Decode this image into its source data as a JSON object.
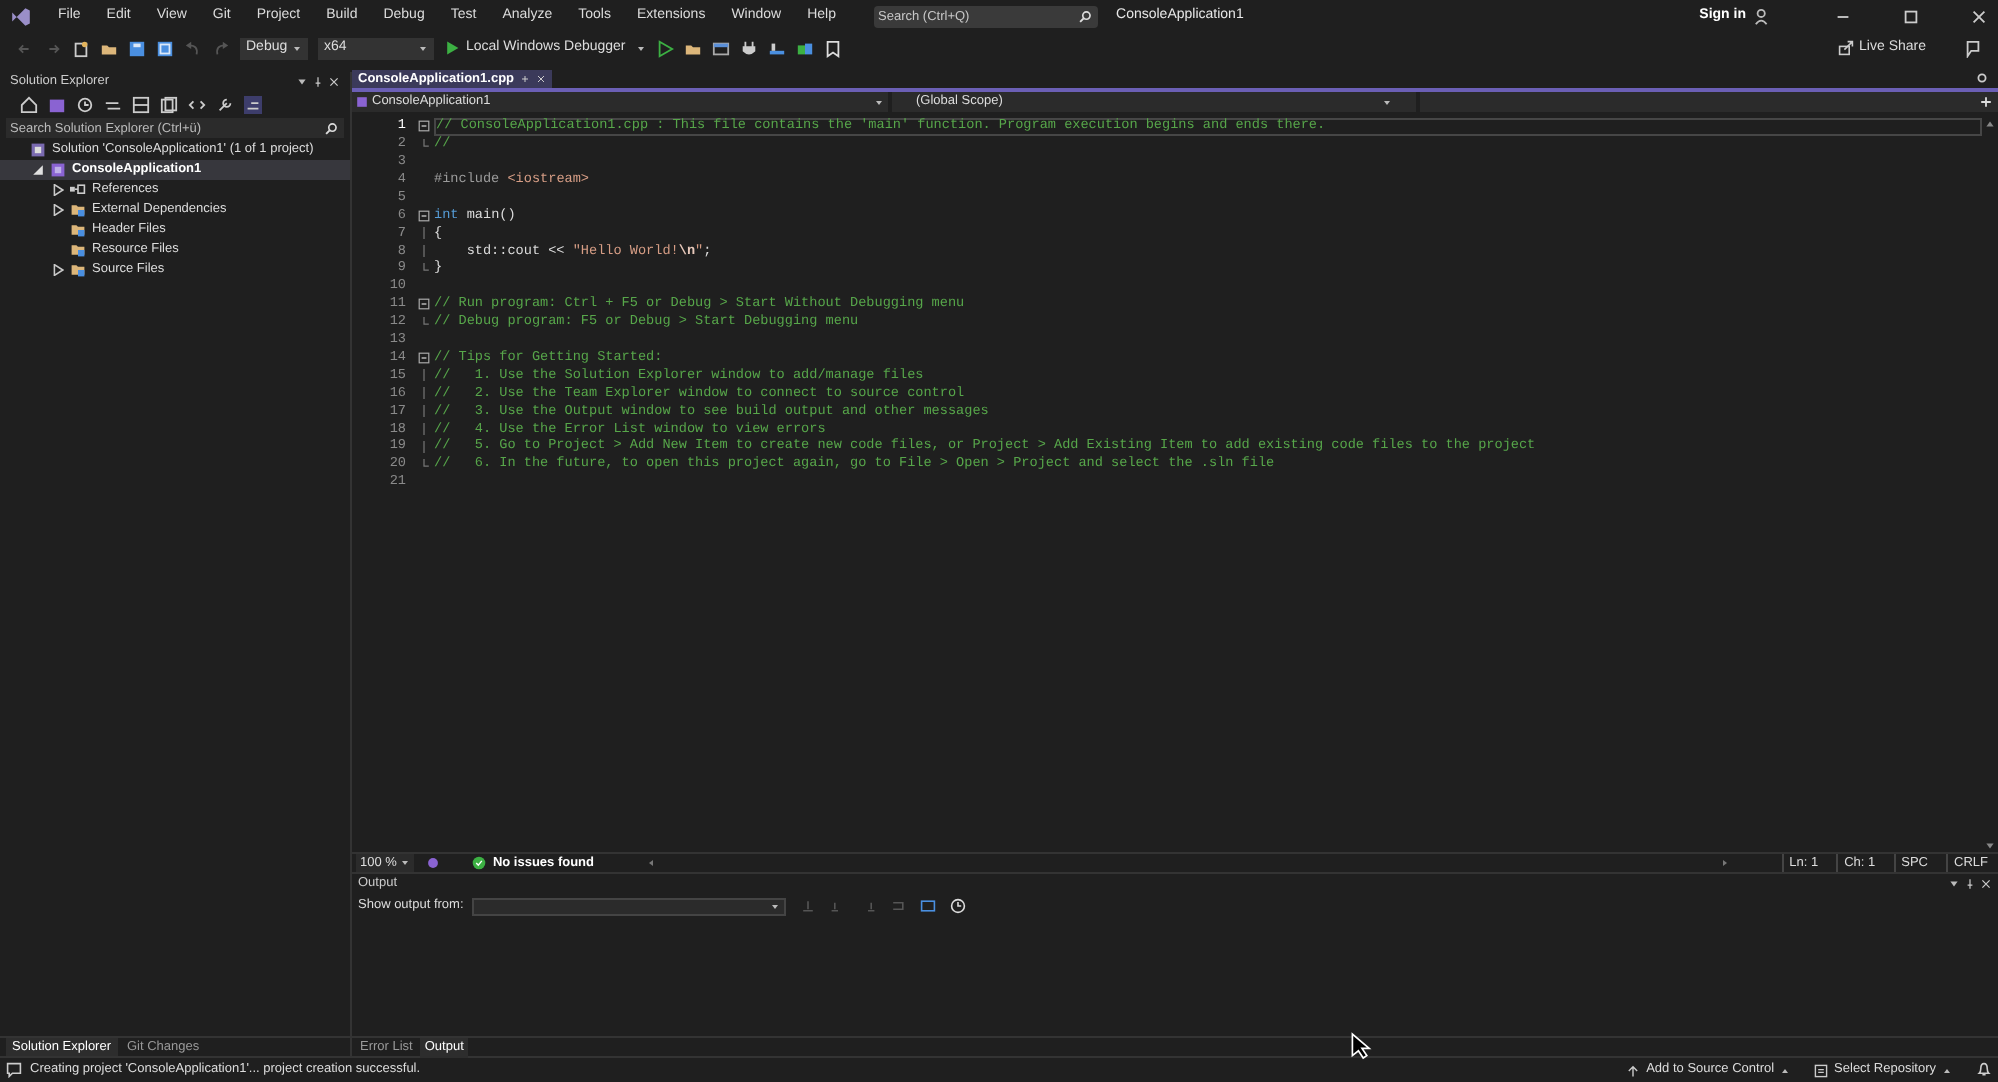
{
  "menu_bar": {
    "items": [
      "File",
      "Edit",
      "View",
      "Git",
      "Project",
      "Build",
      "Debug",
      "Test",
      "Analyze",
      "Tools",
      "Extensions",
      "Window",
      "Help"
    ],
    "search": {
      "placeholder": "Search (Ctrl+Q)"
    },
    "title": "ConsoleApplication1",
    "sign_in": "Sign in"
  },
  "toolbar": {
    "configuration": "Debug",
    "platform": "x64",
    "debugger": "Local Windows Debugger",
    "live_share": "Live Share"
  },
  "solution_explorer": {
    "title": "Solution Explorer",
    "search": {
      "placeholder": "Search Solution Explorer (Ctrl+ü)"
    },
    "tree": [
      {
        "label": "Solution 'ConsoleApplication1' (1 of 1 project)",
        "kind": "solution",
        "expandable": false,
        "selected": false,
        "children": [
          {
            "label": "ConsoleApplication1",
            "kind": "project",
            "expandable": true,
            "expanded": true,
            "selected": true,
            "children": [
              {
                "label": "References",
                "kind": "references",
                "expandable": true,
                "expanded": false,
                "selected": false
              },
              {
                "label": "External Dependencies",
                "kind": "folder",
                "expandable": true,
                "expanded": false,
                "selected": false
              },
              {
                "label": "Header Files",
                "kind": "folder",
                "expandable": false,
                "selected": false
              },
              {
                "label": "Resource Files",
                "kind": "folder",
                "expandable": false,
                "selected": false
              },
              {
                "label": "Source Files",
                "kind": "folder",
                "expandable": true,
                "expanded": false,
                "selected": false
              }
            ]
          }
        ]
      }
    ]
  },
  "editor": {
    "tabs": [
      {
        "label": "ConsoleApplication1.cpp",
        "selected": true
      }
    ],
    "nav": {
      "project": "ConsoleApplication1",
      "scope": "(Global Scope)"
    },
    "lines": [
      {
        "number": "1",
        "current": true,
        "collapsible": true,
        "in_block": false,
        "tokens": [
          {
            "kind": "comment",
            "text": "// ConsoleApplication1.cpp : This file contains the 'main' function. Program execution begins and ends there."
          }
        ]
      },
      {
        "number": "2",
        "current": false,
        "collapsible": false,
        "in_block": true,
        "tokens": [
          {
            "kind": "comment",
            "text": "//"
          }
        ]
      },
      {
        "number": "3",
        "current": false,
        "collapsible": false,
        "in_block": false
      },
      {
        "number": "4",
        "current": false,
        "collapsible": false,
        "in_block": false,
        "tokens": [
          {
            "kind": "preproc",
            "text": "#include "
          },
          {
            "kind": "string",
            "text": "<iostream>"
          }
        ]
      },
      {
        "number": "5",
        "current": false,
        "collapsible": false,
        "in_block": false
      },
      {
        "number": "6",
        "current": false,
        "collapsible": true,
        "in_block": false,
        "tokens": [
          {
            "kind": "keyword",
            "text": "int"
          },
          {
            "kind": "plain",
            "text": " main()"
          }
        ]
      },
      {
        "number": "7",
        "current": false,
        "collapsible": false,
        "in_block": true,
        "tokens": [
          {
            "kind": "plain",
            "text": "{"
          }
        ]
      },
      {
        "number": "8",
        "current": false,
        "collapsible": false,
        "in_block": true,
        "tokens": [
          {
            "kind": "plain",
            "text": "    std::cout << "
          },
          {
            "kind": "string",
            "text": "\"Hello World!"
          },
          {
            "kind": "escape",
            "text": "\\n"
          },
          {
            "kind": "string",
            "text": "\""
          },
          {
            "kind": "plain",
            "text": ";"
          }
        ]
      },
      {
        "number": "9",
        "current": false,
        "collapsible": false,
        "in_block": true,
        "tokens": [
          {
            "kind": "plain",
            "text": "}"
          }
        ]
      },
      {
        "number": "10",
        "current": false,
        "collapsible": false,
        "in_block": false
      },
      {
        "number": "11",
        "current": false,
        "collapsible": true,
        "in_block": false,
        "tokens": [
          {
            "kind": "comment",
            "text": "// Run program: Ctrl + F5 or Debug > Start Without Debugging menu"
          }
        ]
      },
      {
        "number": "12",
        "current": false,
        "collapsible": false,
        "in_block": true,
        "tokens": [
          {
            "kind": "comment",
            "text": "// Debug program: F5 or Debug > Start Debugging menu"
          }
        ]
      },
      {
        "number": "13",
        "current": false,
        "collapsible": false,
        "in_block": false
      },
      {
        "number": "14",
        "current": false,
        "collapsible": true,
        "in_block": false,
        "tokens": [
          {
            "kind": "comment",
            "text": "// Tips for Getting Started:"
          }
        ]
      },
      {
        "number": "15",
        "current": false,
        "collapsible": false,
        "in_block": true,
        "tokens": [
          {
            "kind": "comment",
            "text": "//   1. Use the Solution Explorer window to add/manage files"
          }
        ]
      },
      {
        "number": "16",
        "current": false,
        "collapsible": false,
        "in_block": true,
        "tokens": [
          {
            "kind": "comment",
            "text": "//   2. Use the Team Explorer window to connect to source control"
          }
        ]
      },
      {
        "number": "17",
        "current": false,
        "collapsible": false,
        "in_block": true,
        "tokens": [
          {
            "kind": "comment",
            "text": "//   3. Use the Output window to see build output and other messages"
          }
        ]
      },
      {
        "number": "18",
        "current": false,
        "collapsible": false,
        "in_block": true,
        "tokens": [
          {
            "kind": "comment",
            "text": "//   4. Use the Error List window to view errors"
          }
        ]
      },
      {
        "number": "19",
        "current": false,
        "collapsible": false,
        "in_block": true,
        "tokens": [
          {
            "kind": "comment",
            "text": "//   5. Go to Project > Add New Item to create new code files, or Project > Add Existing Item to add existing code files to the project"
          }
        ]
      },
      {
        "number": "20",
        "current": false,
        "collapsible": false,
        "in_block": true,
        "tokens": [
          {
            "kind": "comment",
            "text": "//   6. In the future, to open this project again, go to File > Open > Project and select the .sln file"
          }
        ]
      },
      {
        "number": "21",
        "current": false,
        "collapsible": false,
        "in_block": false
      }
    ],
    "status": {
      "zoom": "100 %",
      "issues": "No issues found",
      "line": "Ln: 1",
      "column": "Ch: 1",
      "whitespace": "SPC",
      "line_endings": "CRLF"
    }
  },
  "output": {
    "title": "Output",
    "show_from": "Show output from:"
  },
  "left_tabs": [
    {
      "label": "Solution Explorer",
      "selected": true
    },
    {
      "label": "Git Changes",
      "selected": false
    }
  ],
  "bottom_tabs": [
    {
      "label": "Error List",
      "selected": false
    },
    {
      "label": "Output",
      "selected": true
    }
  ],
  "status_bar": {
    "message": "Creating project 'ConsoleApplication1'... project creation successful.",
    "source_control": "Add to Source Control",
    "repository": "Select Repository"
  }
}
